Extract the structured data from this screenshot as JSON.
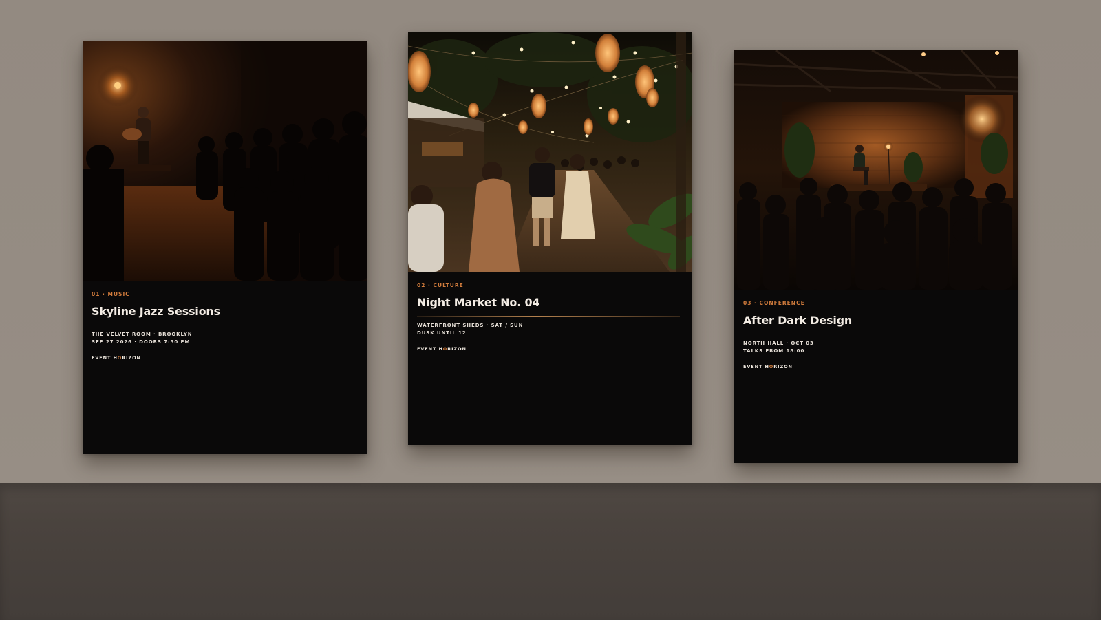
{
  "posters": [
    {
      "category": "01 · MUSIC",
      "title": "Skyline Jazz Sessions",
      "details_line1": "THE VELVET ROOM · BROOKLYN",
      "details_line2": "SEP 27 2026 · DOORS 7:30 PM",
      "brand_pre": "EVENT H",
      "brand_accent": "O",
      "brand_post": "RIZON",
      "image": "jazz-performance-photo"
    },
    {
      "category": "02 · CULTURE",
      "title": "Night Market No. 04",
      "details_line1": "WATERFRONT SHEDS · SAT / SUN",
      "details_line2": "DUSK UNTIL 12",
      "brand_pre": "EVENT H",
      "brand_accent": "O",
      "brand_post": "RIZON",
      "image": "night-market-photo"
    },
    {
      "category": "03 · CONFERENCE",
      "title": "After Dark Design",
      "details_line1": "NORTH HALL · OCT 03",
      "details_line2": "TALKS FROM 18:00",
      "brand_pre": "EVENT H",
      "brand_accent": "O",
      "brand_post": "RIZON",
      "image": "conference-talk-photo"
    }
  ],
  "colors": {
    "wall": "#948b82",
    "shelf": "#4a433e",
    "poster_bg": "#0a0909",
    "accent": "#d07b3c",
    "title": "#f3ece4"
  }
}
